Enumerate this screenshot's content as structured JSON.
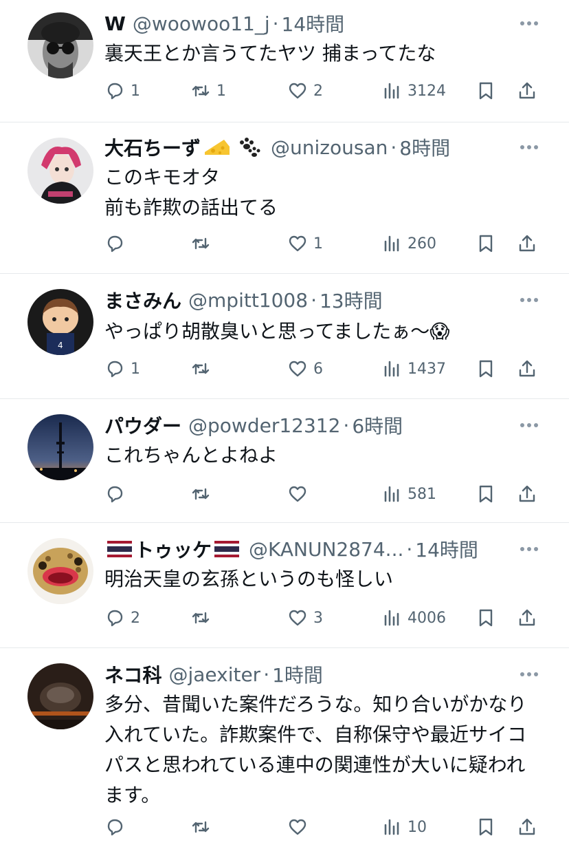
{
  "tweets": [
    {
      "name": "W",
      "handle": "@woowoo11_j",
      "time": "14時間",
      "text": "裏天王とか言うてたヤツ 捕まってたな",
      "replies": "1",
      "retweets": "1",
      "likes": "2",
      "views": "3124",
      "avatar": "avatar-man-sunglasses"
    },
    {
      "name": "大石ちーず",
      "name_emoji": [
        "cheese-emoji",
        "paw-prints-emoji"
      ],
      "handle": "@unizousan",
      "time": "8時間",
      "text": "このキモオタ\n前も詐欺の話出てる",
      "replies": "",
      "retweets": "",
      "likes": "1",
      "views": "260",
      "avatar": "avatar-anime-pink-hair"
    },
    {
      "name": "まさみん",
      "handle": "@mpitt1008",
      "time": "13時間",
      "text": "やっぱり胡散臭いと思ってましたぁ〜😱",
      "replies": "1",
      "retweets": "",
      "likes": "6",
      "views": "1437",
      "avatar": "avatar-plush-doll"
    },
    {
      "name": "パウダー",
      "handle": "@powder12312",
      "time": "6時間",
      "text": "これちゃんとよねよ",
      "replies": "",
      "retweets": "",
      "likes": "",
      "views": "581",
      "avatar": "avatar-night-tower"
    },
    {
      "name": "トゥッケ",
      "name_emoji": [
        "thailand-flag-emoji",
        "thailand-flag-emoji"
      ],
      "handle": "@KANUN2874...",
      "time": "14時間",
      "text": "明治天皇の玄孫というのも怪しい",
      "replies": "2",
      "retweets": "",
      "likes": "3",
      "views": "4006",
      "avatar": "avatar-gecko"
    },
    {
      "name": "ネコ科",
      "handle": "@jaexiter",
      "time": "1時間",
      "text": "多分、昔聞いた案件だろうな。知り合いがかなり入れていた。詐欺案件で、自称保守や最近サイコパスと思われている連中の関連性が大いに疑われます。",
      "replies": "",
      "retweets": "",
      "likes": "",
      "views": "10",
      "avatar": "avatar-dark-object"
    }
  ],
  "dot": "·",
  "colors": {
    "text": "#0f1419",
    "secondary": "#536471",
    "divider": "#e6e9ec"
  }
}
